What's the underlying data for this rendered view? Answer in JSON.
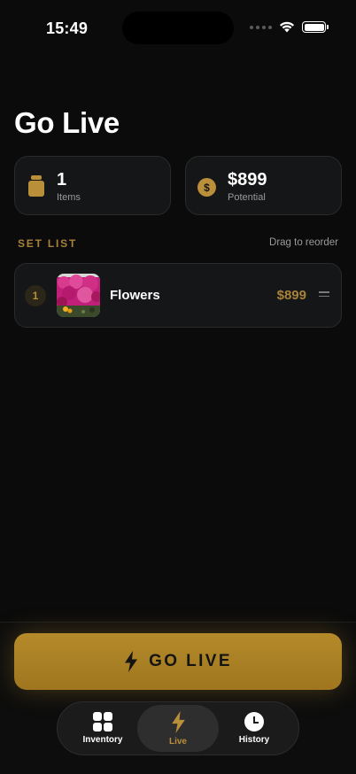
{
  "status_bar": {
    "time": "15:49"
  },
  "page": {
    "title": "Go Live"
  },
  "stats": {
    "items": {
      "value": "1",
      "label": "Items",
      "icon": "jar-icon"
    },
    "potential": {
      "value": "$899",
      "label": "Potential",
      "icon": "dollar-coin-icon",
      "coin_symbol": "$"
    }
  },
  "set_list": {
    "header": "SET LIST",
    "hint": "Drag to reorder",
    "items": [
      {
        "index": "1",
        "name": "Flowers",
        "price": "$899"
      }
    ]
  },
  "go_live_button": {
    "label": "GO LIVE",
    "icon": "lightning-bolt-icon"
  },
  "tab_bar": {
    "tabs": [
      {
        "label": "Inventory",
        "icon": "grid-icon",
        "selected": false
      },
      {
        "label": "Live",
        "icon": "lightning-bolt-icon",
        "selected": true
      },
      {
        "label": "History",
        "icon": "clock-icon",
        "selected": false
      }
    ]
  },
  "colors": {
    "background": "#0b0b0b",
    "card": "#151617",
    "accent": "#b98f3a",
    "accent_text": "#a8823a"
  }
}
